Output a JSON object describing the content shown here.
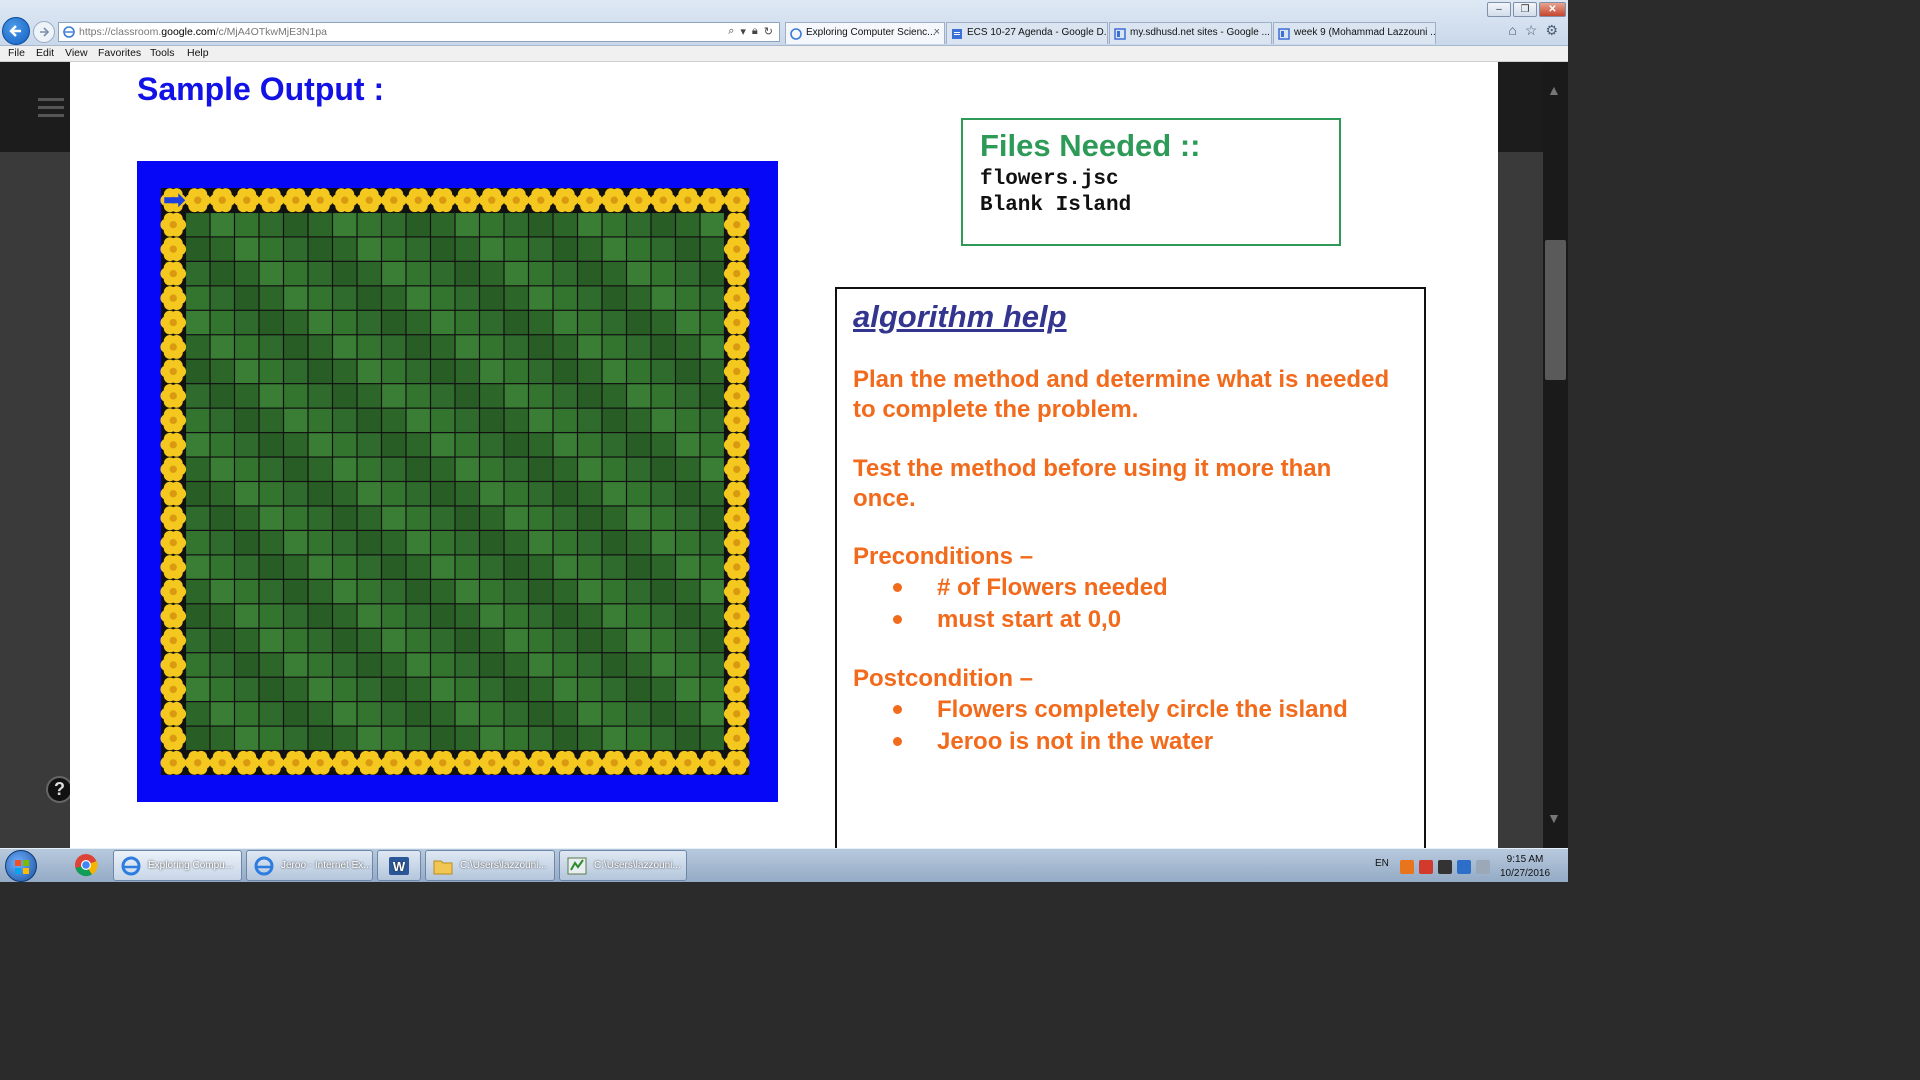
{
  "browser": {
    "url_prefix": "https://classroom.",
    "url_domain": "google.com",
    "url_path": "/c/MjA4OTkwMjE3N1pa",
    "tabs": [
      {
        "label": "Exploring Computer Scienc...",
        "close": "×"
      },
      {
        "label": "ECS 10-27 Agenda - Google D..."
      },
      {
        "label": "my.sdhusd.net sites - Google ..."
      },
      {
        "label": "week 9 (Mohammad Lazzouni ..."
      }
    ],
    "menu": [
      "File",
      "Edit",
      "View",
      "Favorites",
      "Tools",
      "Help"
    ]
  },
  "slide": {
    "title": "Sample Output :",
    "files_box": {
      "title": "Files Needed ::",
      "lines": [
        "flowers.jsc",
        "Blank Island"
      ]
    },
    "algorithm": {
      "title": "algorithm help",
      "para1": "Plan the method and determine what is needed to complete the problem.",
      "para2": "Test the method before using it more than once.",
      "pre_heading": "Preconditions –",
      "pre_bullets": [
        "# of Flowers needed",
        "must start at 0,0"
      ],
      "post_heading": "Postcondition –",
      "post_bullets": [
        "Flowers completely circle the island",
        "Jeroo is not in the water"
      ]
    }
  },
  "help_button": "?",
  "taskbar": {
    "tasks": [
      {
        "label": "Exploring Compu..."
      },
      {
        "label": "Jeroo - Internet Ex..."
      },
      {
        "label": ""
      },
      {
        "label": "C:\\Users\\lazzouni..."
      },
      {
        "label": "C:\\Users\\lazzouni..."
      }
    ],
    "lang": "EN",
    "time": "9:15 AM",
    "date": "10/27/2016"
  },
  "colors": {
    "title_blue": "#1212e6",
    "files_green": "#2e9a57",
    "algo_orange": "#f26a1b",
    "algo_title": "#33358f",
    "water": "#0707f8",
    "grass": "#2f6b2c",
    "flower": "#f4c81e"
  },
  "island": {
    "grid_cols": 24,
    "grid_rows": 24,
    "flower_ring": true,
    "jeroo_position": [
      0,
      0
    ],
    "icons": [
      "flower-icon",
      "jeroo-icon",
      "grass-tile"
    ]
  }
}
